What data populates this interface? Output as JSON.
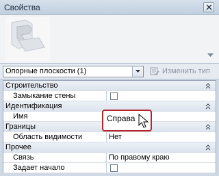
{
  "window": {
    "title": "Свойства"
  },
  "type_selector": {
    "value": "Опорные плоскости (1)"
  },
  "edit_type": {
    "label": "Изменить тип"
  },
  "groups": [
    {
      "name": "Строительство",
      "props": [
        {
          "name": "Замыкание стены",
          "checkbox": true
        }
      ]
    },
    {
      "name": "Идентификация",
      "props": [
        {
          "name": "Имя",
          "value": "Справа"
        }
      ]
    },
    {
      "name": "Границы",
      "props": [
        {
          "name": "Область видимости",
          "value": "Нет"
        }
      ]
    },
    {
      "name": "Прочее",
      "props": [
        {
          "name": "Связь",
          "value": "По правому краю"
        },
        {
          "name": "Задает начало",
          "checkbox": true
        }
      ]
    }
  ],
  "colors": {
    "highlight_border": "#b3252b",
    "panel_bg": "#cfd9e6",
    "group_bg": "#dde4ee"
  },
  "icons": [
    "close-icon",
    "type-image",
    "dropdown-arrow-icon",
    "edit-type-icon",
    "collapse-icon",
    "mouse-cursor-icon"
  ]
}
